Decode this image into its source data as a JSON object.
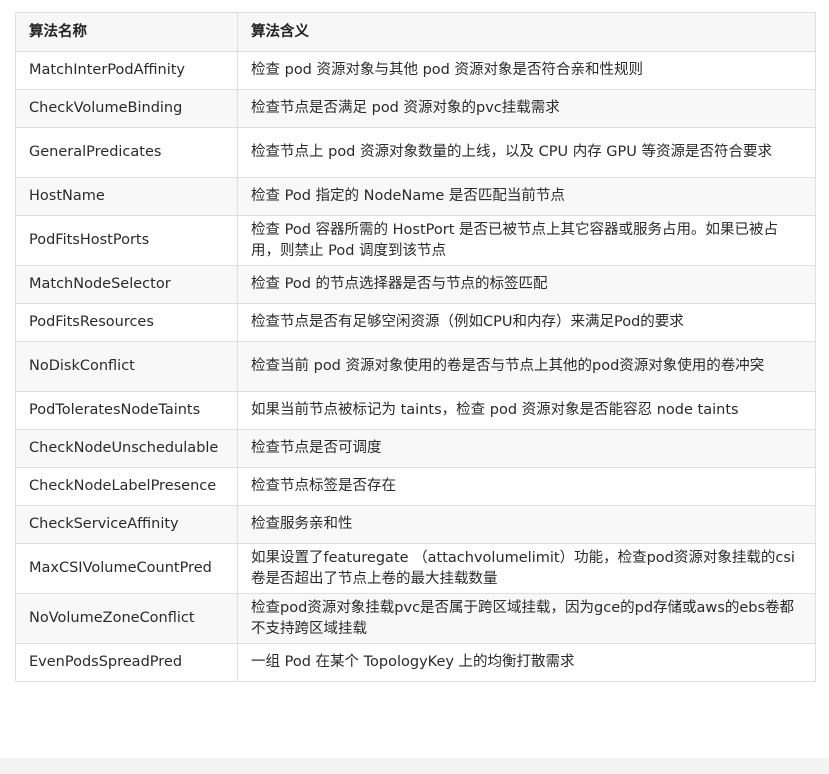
{
  "table": {
    "headers": [
      "算法名称",
      "算法含义"
    ],
    "rows": [
      {
        "name": "MatchInterPodAffinity",
        "desc": "检查 pod 资源对象与其他 pod 资源对象是否符合亲和性规则"
      },
      {
        "name": "CheckVolumeBinding",
        "desc": "检查节点是否满足 pod 资源对象的pvc挂载需求"
      },
      {
        "name": "GeneralPredicates",
        "desc": "检查节点上 pod 资源对象数量的上线，以及 CPU 内存 GPU 等资源是否符合要求"
      },
      {
        "name": "HostName",
        "desc": "检查 Pod 指定的 NodeName 是否匹配当前节点"
      },
      {
        "name": "PodFitsHostPorts",
        "desc": "检查 Pod 容器所需的 HostPort 是否已被节点上其它容器或服务占用。如果已被占用，则禁止 Pod 调度到该节点"
      },
      {
        "name": "MatchNodeSelector",
        "desc": "检查 Pod 的节点选择器是否与节点的标签匹配"
      },
      {
        "name": "PodFitsResources",
        "desc": "检查节点是否有足够空闲资源（例如CPU和内存）来满足Pod的要求"
      },
      {
        "name": "NoDiskConflict",
        "desc": "检查当前 pod 资源对象使用的卷是否与节点上其他的pod资源对象使用的卷冲突"
      },
      {
        "name": "PodToleratesNodeTaints",
        "desc": "如果当前节点被标记为 taints，检查 pod 资源对象是否能容忍 node taints"
      },
      {
        "name": "CheckNodeUnschedulable",
        "desc": "检查节点是否可调度"
      },
      {
        "name": "CheckNodeLabelPresence",
        "desc": "检查节点标签是否存在"
      },
      {
        "name": "CheckServiceAffinity",
        "desc": "检查服务亲和性"
      },
      {
        "name": "MaxCSIVolumeCountPred",
        "desc": "如果设置了featuregate （attachvolumelimit）功能，检查pod资源对象挂载的csi卷是否超出了节点上卷的最大挂载数量"
      },
      {
        "name": "NoVolumeZoneConflict",
        "desc": "检查pod资源对象挂载pvc是否属于跨区域挂载，因为gce的pd存储或aws的ebs卷都不支持跨区域挂载"
      },
      {
        "name": "EvenPodsSpreadPred",
        "desc": "一组 Pod 在某个 TopologyKey 上的均衡打散需求"
      }
    ]
  }
}
